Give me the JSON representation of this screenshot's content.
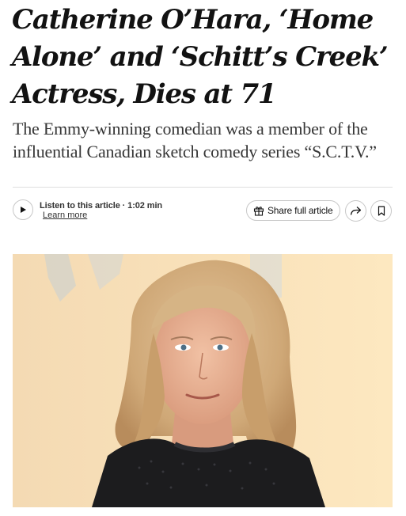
{
  "article": {
    "headline": "Catherine O’Hara, ‘Home Alone’ and ‘Schitt’s Creek’ Actress, Dies at 71",
    "summary": "The Emmy-winning comedian was a member of the influential Canadian sketch comedy series “S.C.T.V.”"
  },
  "toolbar": {
    "listen_label": "Listen to this article · 1:02 min",
    "learn_more": "Learn more",
    "share_label": "Share full article"
  },
  "icons": {
    "play": "play-icon",
    "gift": "gift-icon",
    "share": "share-arrow-icon",
    "bookmark": "bookmark-icon"
  },
  "photo": {
    "subject": "portrait photograph"
  }
}
